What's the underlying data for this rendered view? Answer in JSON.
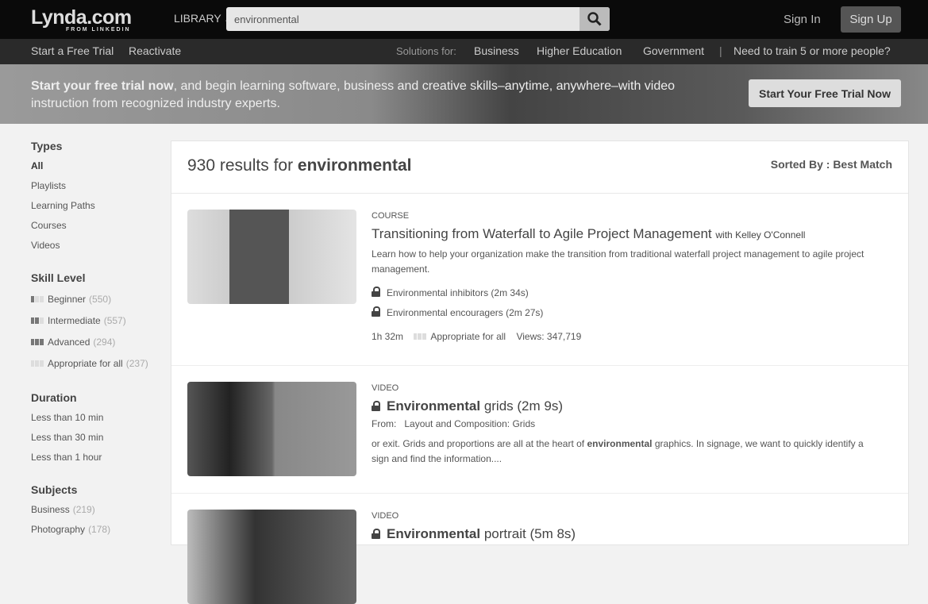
{
  "header": {
    "logo": "Lynda.com",
    "logo_sub": "FROM LINKEDIN",
    "library": "LIBRARY",
    "search_value": "environmental",
    "sign_in": "Sign In",
    "sign_up": "Sign Up"
  },
  "nav": {
    "free_trial": "Start a Free Trial",
    "reactivate": "Reactivate",
    "solutions": "Solutions for:",
    "business": "Business",
    "higher_ed": "Higher Education",
    "government": "Government",
    "train": "Need to train 5 or more people?"
  },
  "banner": {
    "bold": "Start your free trial now",
    "text": ", and begin learning software, business and creative skills–anytime, anywhere–with video instruction from recognized industry experts.",
    "button": "Start Your Free Trial Now"
  },
  "sidebar": {
    "types": {
      "title": "Types",
      "items": [
        "All",
        "Playlists",
        "Learning Paths",
        "Courses",
        "Videos"
      ]
    },
    "skill": {
      "title": "Skill Level",
      "items": [
        {
          "label": "Beginner",
          "count": "(550)"
        },
        {
          "label": "Intermediate",
          "count": "(557)"
        },
        {
          "label": "Advanced",
          "count": "(294)"
        },
        {
          "label": "Appropriate for all",
          "count": "(237)"
        }
      ]
    },
    "duration": {
      "title": "Duration",
      "items": [
        "Less than 10 min",
        "Less than 30 min",
        "Less than 1 hour"
      ]
    },
    "subjects": {
      "title": "Subjects",
      "items": [
        {
          "label": "Business",
          "count": "(219)"
        },
        {
          "label": "Photography",
          "count": "(178)"
        }
      ]
    }
  },
  "results": {
    "count": "930",
    "results_for": " results for ",
    "query": "environmental",
    "sorted": "Sorted By : Best Match",
    "items": [
      {
        "type": "COURSE",
        "title": "Transitioning from Waterfall to Agile Project Management",
        "author": "with Kelley O'Connell",
        "desc": "Learn how to help your organization make the transition from traditional waterfall project management to agile project management.",
        "videos": [
          "Environmental inhibitors (2m 34s)",
          "Environmental encouragers (2m 27s)"
        ],
        "duration": "1h 32m",
        "level": "Appropriate for all",
        "views": "Views: 347,719"
      },
      {
        "type": "VIDEO",
        "title_bold": "Environmental",
        "title_rest": " grids (2m 9s)",
        "from_label": "From:",
        "from": "Layout and Composition: Grids",
        "desc_a": "or exit. Grids and proportions are all at the heart of ",
        "desc_bold": "environmental",
        "desc_b": " graphics. In signage, we want to quickly identify a sign and find the information...."
      },
      {
        "type": "VIDEO",
        "title_bold": "Environmental",
        "title_rest": " portrait (5m 8s)"
      }
    ]
  }
}
